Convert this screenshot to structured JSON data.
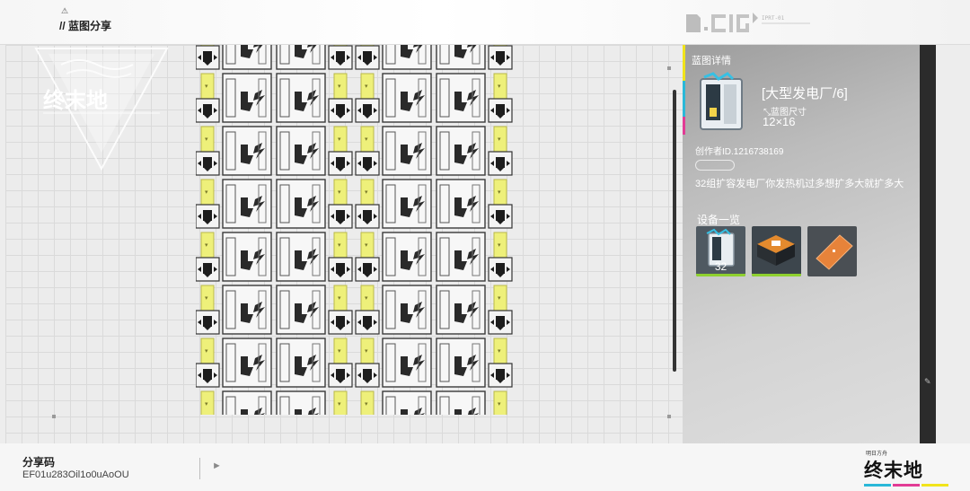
{
  "header": {
    "warn_glyph": "⚠",
    "title": "// 蓝图分享",
    "deco_text": "IPRT-01"
  },
  "canvas": {
    "logo_text": "终末地",
    "logo_icon": "endfield-logo-watermark"
  },
  "panel": {
    "heading": "蓝图详情",
    "name": "[大型发电厂/6]",
    "size_label": "蓝图尺寸",
    "size_value": "12×16",
    "creator": "创作者ID.1216738169",
    "description": "32组扩容发电厂你发热机过多想扩多大就扩多大",
    "device_heading": "设备一览",
    "devices": [
      {
        "icon": "power-generator-icon",
        "count": "32"
      },
      {
        "icon": "machine-base-icon",
        "count": ""
      },
      {
        "icon": "orange-floor-tile-icon",
        "count": ""
      }
    ],
    "accent_colors": {
      "yellow": "#f1e41b",
      "cyan": "#2ab8d8",
      "magenta": "#e23b95",
      "green": "#8fd12f"
    }
  },
  "footer": {
    "code_label": "分享码",
    "code_value": "EF01u283Oil1o0uAoOU",
    "brand_small": "明日方舟",
    "brand_text": "终末地"
  }
}
